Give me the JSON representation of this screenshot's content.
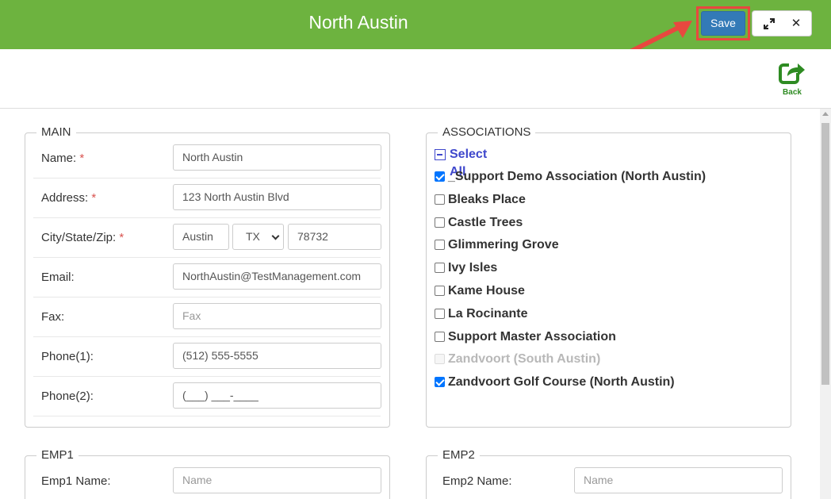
{
  "header": {
    "title": "North Austin",
    "save_label": "Save",
    "expand_icon": "expand-icon",
    "close_glyph": "✕"
  },
  "toolbar": {
    "back_label": "Back"
  },
  "main": {
    "legend": "MAIN",
    "name_label": "Name:",
    "name_value": "North Austin",
    "address_label": "Address:",
    "address_value": "123 North Austin Blvd",
    "city_label": "City/State/Zip:",
    "city_value": "Austin",
    "state_value": "TX",
    "zip_value": "78732",
    "email_label": "Email:",
    "email_value": "NorthAustin@TestManagement.com",
    "fax_label": "Fax:",
    "fax_placeholder": "Fax",
    "phone1_label": "Phone(1):",
    "phone1_value": "(512) 555-5555",
    "phone2_label": "Phone(2):",
    "phone2_value": "(___) ___-____",
    "required_mark": "*"
  },
  "associations": {
    "legend": "ASSOCIATIONS",
    "select_all_label": "Select All",
    "items": [
      {
        "label": "_Support Demo Association (North Austin)",
        "checked": true,
        "disabled": false
      },
      {
        "label": "Bleaks Place",
        "checked": false,
        "disabled": false
      },
      {
        "label": "Castle Trees",
        "checked": false,
        "disabled": false
      },
      {
        "label": "Glimmering Grove",
        "checked": false,
        "disabled": false
      },
      {
        "label": "Ivy Isles",
        "checked": false,
        "disabled": false
      },
      {
        "label": "Kame House",
        "checked": false,
        "disabled": false
      },
      {
        "label": "La Rocinante",
        "checked": false,
        "disabled": false
      },
      {
        "label": "Support Master Association",
        "checked": false,
        "disabled": false
      },
      {
        "label": "Zandvoort (South Austin)",
        "checked": false,
        "disabled": true
      },
      {
        "label": "Zandvoort Golf Course (North Austin)",
        "checked": true,
        "disabled": false
      }
    ]
  },
  "emp1": {
    "legend": "EMP1",
    "name_label": "Emp1 Name:",
    "name_placeholder": "Name"
  },
  "emp2": {
    "legend": "EMP2",
    "name_label": "Emp2 Name:",
    "name_placeholder": "Name"
  },
  "colors": {
    "header_green": "#6db33f",
    "save_blue": "#337ab7",
    "highlight_red": "#e8483f",
    "select_all_blue": "#3f48cc",
    "back_green": "#2e8b22"
  }
}
